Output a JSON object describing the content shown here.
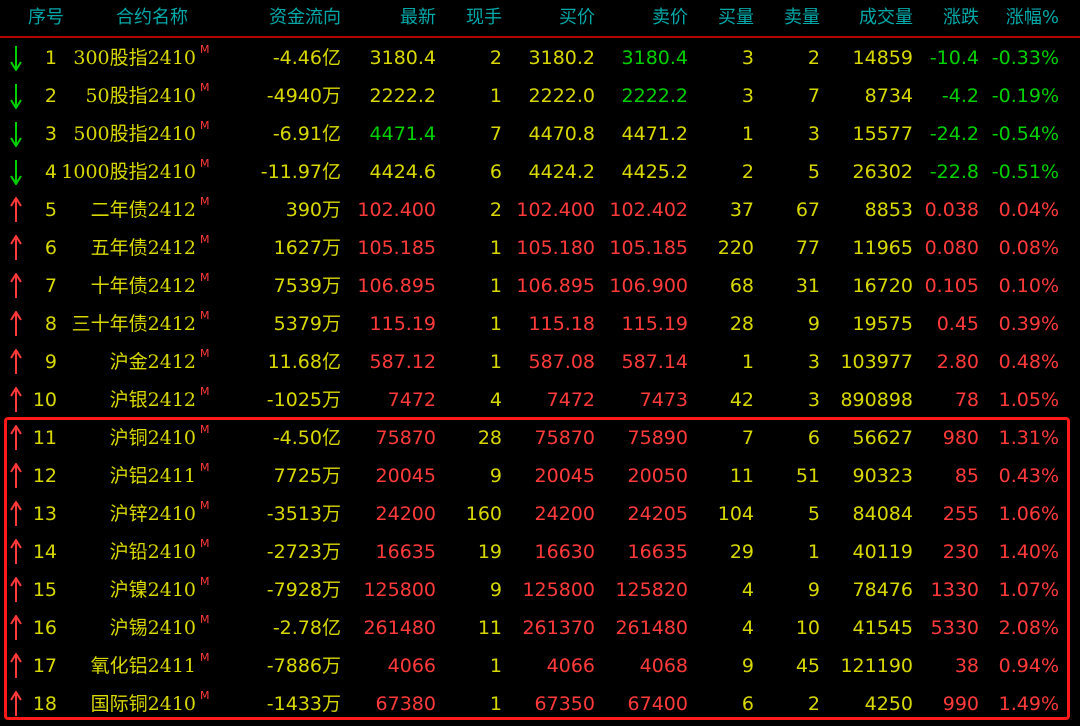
{
  "headers": {
    "idx": "序号",
    "name": "合约名称",
    "flow": "资金流向",
    "last": "最新",
    "cur": "现手",
    "bid": "买价",
    "ask": "卖价",
    "bidv": "买量",
    "askv": "卖量",
    "vol": "成交量",
    "chg": "涨跌",
    "pct": "涨幅%"
  },
  "colors": {
    "y": "#d8d800",
    "g": "#00d000",
    "r": "#ff3a3a",
    "header": "#00a8a8",
    "highlight_box": "#ff1a1a"
  },
  "contract_marker": "M",
  "rows": [
    {
      "idx": "1",
      "dir": "down",
      "name": "300股指2410",
      "flow": "-4.46亿",
      "last": "3180.4",
      "cur": "2",
      "bid": "3180.2",
      "ask": "3180.4",
      "bidv": "3",
      "askv": "2",
      "vol": "14859",
      "chg": "-10.4",
      "pct": "-0.33%",
      "c": {
        "last": "y",
        "bid": "y",
        "ask": "g",
        "chg": "g"
      }
    },
    {
      "idx": "2",
      "dir": "down",
      "name": "50股指2410",
      "flow": "-4940万",
      "last": "2222.2",
      "cur": "1",
      "bid": "2222.0",
      "ask": "2222.2",
      "bidv": "3",
      "askv": "7",
      "vol": "8734",
      "chg": "-4.2",
      "pct": "-0.19%",
      "c": {
        "last": "y",
        "bid": "y",
        "ask": "g",
        "chg": "g"
      }
    },
    {
      "idx": "3",
      "dir": "down",
      "name": "500股指2410",
      "flow": "-6.91亿",
      "last": "4471.4",
      "cur": "7",
      "bid": "4470.8",
      "ask": "4471.2",
      "bidv": "1",
      "askv": "3",
      "vol": "15577",
      "chg": "-24.2",
      "pct": "-0.54%",
      "c": {
        "last": "g",
        "bid": "y",
        "ask": "y",
        "chg": "g"
      }
    },
    {
      "idx": "4",
      "dir": "down",
      "name": "1000股指2410",
      "flow": "-11.97亿",
      "last": "4424.6",
      "cur": "6",
      "bid": "4424.2",
      "ask": "4425.2",
      "bidv": "2",
      "askv": "5",
      "vol": "26302",
      "chg": "-22.8",
      "pct": "-0.51%",
      "c": {
        "last": "y",
        "bid": "y",
        "ask": "y",
        "chg": "g"
      }
    },
    {
      "idx": "5",
      "dir": "up",
      "name": "二年债2412",
      "flow": "390万",
      "last": "102.400",
      "cur": "2",
      "bid": "102.400",
      "ask": "102.402",
      "bidv": "37",
      "askv": "67",
      "vol": "8853",
      "chg": "0.038",
      "pct": "0.04%",
      "c": {
        "last": "r",
        "bid": "r",
        "ask": "r",
        "chg": "r"
      }
    },
    {
      "idx": "6",
      "dir": "up",
      "name": "五年债2412",
      "flow": "1627万",
      "last": "105.185",
      "cur": "1",
      "bid": "105.180",
      "ask": "105.185",
      "bidv": "220",
      "askv": "77",
      "vol": "11965",
      "chg": "0.080",
      "pct": "0.08%",
      "c": {
        "last": "r",
        "bid": "r",
        "ask": "r",
        "chg": "r"
      }
    },
    {
      "idx": "7",
      "dir": "up",
      "name": "十年债2412",
      "flow": "7539万",
      "last": "106.895",
      "cur": "1",
      "bid": "106.895",
      "ask": "106.900",
      "bidv": "68",
      "askv": "31",
      "vol": "16720",
      "chg": "0.105",
      "pct": "0.10%",
      "c": {
        "last": "r",
        "bid": "r",
        "ask": "r",
        "chg": "r"
      }
    },
    {
      "idx": "8",
      "dir": "up",
      "name": "三十年债2412",
      "flow": "5379万",
      "last": "115.19",
      "cur": "1",
      "bid": "115.18",
      "ask": "115.19",
      "bidv": "28",
      "askv": "9",
      "vol": "19575",
      "chg": "0.45",
      "pct": "0.39%",
      "c": {
        "last": "r",
        "bid": "r",
        "ask": "r",
        "chg": "r"
      }
    },
    {
      "idx": "9",
      "dir": "up",
      "name": "沪金2412",
      "flow": "11.68亿",
      "last": "587.12",
      "cur": "1",
      "bid": "587.08",
      "ask": "587.14",
      "bidv": "1",
      "askv": "3",
      "vol": "103977",
      "chg": "2.80",
      "pct": "0.48%",
      "c": {
        "last": "r",
        "bid": "r",
        "ask": "r",
        "chg": "r"
      }
    },
    {
      "idx": "10",
      "dir": "up",
      "name": "沪银2412",
      "flow": "-1025万",
      "last": "7472",
      "cur": "4",
      "bid": "7472",
      "ask": "7473",
      "bidv": "42",
      "askv": "3",
      "vol": "890898",
      "chg": "78",
      "pct": "1.05%",
      "c": {
        "last": "r",
        "bid": "r",
        "ask": "r",
        "chg": "r"
      }
    },
    {
      "idx": "11",
      "dir": "up",
      "name": "沪铜2410",
      "flow": "-4.50亿",
      "last": "75870",
      "cur": "28",
      "bid": "75870",
      "ask": "75890",
      "bidv": "7",
      "askv": "6",
      "vol": "56627",
      "chg": "980",
      "pct": "1.31%",
      "c": {
        "last": "r",
        "bid": "r",
        "ask": "r",
        "chg": "r"
      }
    },
    {
      "idx": "12",
      "dir": "up",
      "name": "沪铝2411",
      "flow": "7725万",
      "last": "20045",
      "cur": "9",
      "bid": "20045",
      "ask": "20050",
      "bidv": "11",
      "askv": "51",
      "vol": "90323",
      "chg": "85",
      "pct": "0.43%",
      "c": {
        "last": "r",
        "bid": "r",
        "ask": "r",
        "chg": "r"
      }
    },
    {
      "idx": "13",
      "dir": "up",
      "name": "沪锌2410",
      "flow": "-3513万",
      "last": "24200",
      "cur": "160",
      "bid": "24200",
      "ask": "24205",
      "bidv": "104",
      "askv": "5",
      "vol": "84084",
      "chg": "255",
      "pct": "1.06%",
      "c": {
        "last": "r",
        "bid": "r",
        "ask": "r",
        "chg": "r"
      }
    },
    {
      "idx": "14",
      "dir": "up",
      "name": "沪铅2410",
      "flow": "-2723万",
      "last": "16635",
      "cur": "19",
      "bid": "16630",
      "ask": "16635",
      "bidv": "29",
      "askv": "1",
      "vol": "40119",
      "chg": "230",
      "pct": "1.40%",
      "c": {
        "last": "r",
        "bid": "r",
        "ask": "r",
        "chg": "r"
      }
    },
    {
      "idx": "15",
      "dir": "up",
      "name": "沪镍2410",
      "flow": "-7928万",
      "last": "125800",
      "cur": "9",
      "bid": "125800",
      "ask": "125820",
      "bidv": "4",
      "askv": "9",
      "vol": "78476",
      "chg": "1330",
      "pct": "1.07%",
      "c": {
        "last": "r",
        "bid": "r",
        "ask": "r",
        "chg": "r"
      }
    },
    {
      "idx": "16",
      "dir": "up",
      "name": "沪锡2410",
      "flow": "-2.78亿",
      "last": "261480",
      "cur": "11",
      "bid": "261370",
      "ask": "261480",
      "bidv": "4",
      "askv": "10",
      "vol": "41545",
      "chg": "5330",
      "pct": "2.08%",
      "c": {
        "last": "r",
        "bid": "r",
        "ask": "r",
        "chg": "r"
      }
    },
    {
      "idx": "17",
      "dir": "up",
      "name": "氧化铝2411",
      "flow": "-7886万",
      "last": "4066",
      "cur": "1",
      "bid": "4066",
      "ask": "4068",
      "bidv": "9",
      "askv": "45",
      "vol": "121190",
      "chg": "38",
      "pct": "0.94%",
      "c": {
        "last": "r",
        "bid": "r",
        "ask": "r",
        "chg": "r"
      }
    },
    {
      "idx": "18",
      "dir": "up",
      "name": "国际铜2410",
      "flow": "-1433万",
      "last": "67380",
      "cur": "1",
      "bid": "67350",
      "ask": "67400",
      "bidv": "6",
      "askv": "2",
      "vol": "4250",
      "chg": "990",
      "pct": "1.49%",
      "c": {
        "last": "r",
        "bid": "r",
        "ask": "r",
        "chg": "r"
      }
    }
  ]
}
